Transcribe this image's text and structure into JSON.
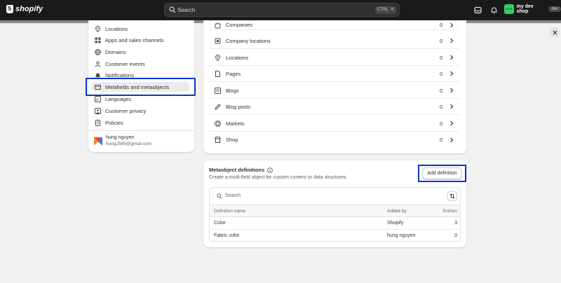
{
  "topbar": {
    "logo_text": "shopify",
    "search_label": "Search",
    "kbd_ctrl": "CTRL",
    "kbd_k": "K",
    "store_avatar": "MDS",
    "store_name": "my dev shop",
    "store_badge": "dev"
  },
  "sidebar": {
    "items": [
      {
        "label": "Locations",
        "icon": "location-icon"
      },
      {
        "label": "Apps and sales channels",
        "icon": "apps-icon"
      },
      {
        "label": "Domains",
        "icon": "globe-icon"
      },
      {
        "label": "Customer events",
        "icon": "customer-events-icon"
      },
      {
        "label": "Notifications",
        "icon": "bell-icon"
      },
      {
        "label": "Metafields and metaobjects",
        "icon": "metafields-icon",
        "active": true
      },
      {
        "label": "Languages",
        "icon": "language-icon"
      },
      {
        "label": "Customer privacy",
        "icon": "privacy-icon"
      },
      {
        "label": "Policies",
        "icon": "policy-icon"
      }
    ],
    "user": {
      "name": "hung nguyen",
      "email": "hung2585@gmail.com"
    }
  },
  "metafields": {
    "rows": [
      {
        "label": "Companies",
        "count": "0",
        "icon": "companies-icon"
      },
      {
        "label": "Company locations",
        "count": "0",
        "icon": "company-location-icon"
      },
      {
        "label": "Locations",
        "count": "0",
        "icon": "location-icon"
      },
      {
        "label": "Pages",
        "count": "0",
        "icon": "page-icon"
      },
      {
        "label": "Blogs",
        "count": "0",
        "icon": "blog-icon"
      },
      {
        "label": "Blog posts",
        "count": "0",
        "icon": "pencil-icon"
      },
      {
        "label": "Markets",
        "count": "0",
        "icon": "markets-icon"
      },
      {
        "label": "Shop",
        "count": "0",
        "icon": "shop-icon"
      }
    ]
  },
  "metaobjects": {
    "title": "Metaobject definitions",
    "description": "Create a multi-field object for custom content or data structures.",
    "add_button": "Add definition",
    "search_placeholder": "Search",
    "columns": [
      "Definition name",
      "Added by",
      "Entries"
    ],
    "rows": [
      {
        "name": "Color",
        "added_by": "Shopify",
        "entries": "3"
      },
      {
        "name": "Fabric color",
        "added_by": "hung nguyen",
        "entries": "0"
      }
    ]
  },
  "colors": {
    "topbar": "#1a1a1a",
    "highlight": "#0b36c2",
    "store_avatar": "#36cf5f"
  }
}
